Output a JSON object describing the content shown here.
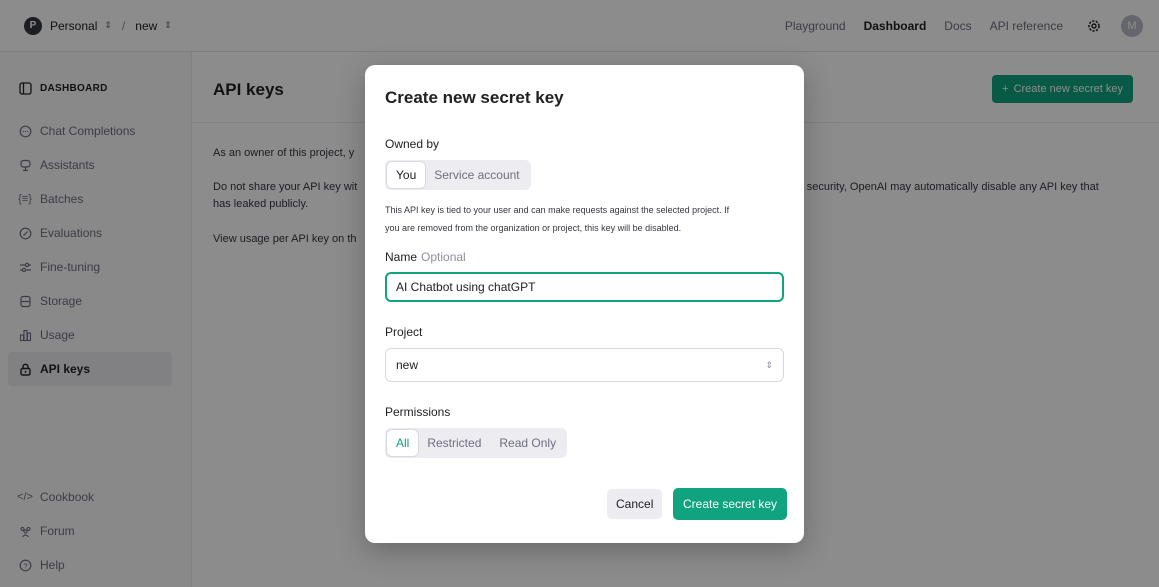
{
  "topbar": {
    "org_initial": "P",
    "org_name": "Personal",
    "separator": "/",
    "project_name": "new",
    "nav": [
      "Playground",
      "Dashboard",
      "Docs",
      "API reference"
    ],
    "active_nav": "Dashboard",
    "avatar_initial": "M"
  },
  "sidebar": {
    "header": "DASHBOARD",
    "items": [
      {
        "label": "Chat Completions",
        "icon": "chat-bubble-icon"
      },
      {
        "label": "Assistants",
        "icon": "assistant-icon"
      },
      {
        "label": "Batches",
        "icon": "batches-icon"
      },
      {
        "label": "Evaluations",
        "icon": "evaluations-icon"
      },
      {
        "label": "Fine-tuning",
        "icon": "fine-tuning-icon"
      },
      {
        "label": "Storage",
        "icon": "database-icon"
      },
      {
        "label": "Usage",
        "icon": "bar-chart-icon"
      },
      {
        "label": "API keys",
        "icon": "lock-icon"
      }
    ],
    "active_item": "API keys",
    "bottom_items": [
      {
        "label": "Cookbook",
        "icon": "code-icon"
      },
      {
        "label": "Forum",
        "icon": "people-icon"
      },
      {
        "label": "Help",
        "icon": "help-icon"
      }
    ]
  },
  "main": {
    "title": "API keys",
    "create_button": "Create new secret key",
    "para1_start": "As an owner of this project, y",
    "para2_start": "Do not share your API key wit",
    "para2_end": "t's security, OpenAI may automatically disable any API key that",
    "para2_line2": "has leaked publicly.",
    "para3_start": "View usage per API key on th"
  },
  "modal": {
    "title": "Create new secret key",
    "owned_by_label": "Owned by",
    "owned_by_options": [
      "You",
      "Service account"
    ],
    "owned_by_selected": "You",
    "help_line1": "This API key is tied to your user and can make requests against the selected project. If",
    "help_line2": "you are removed from the organization or project, this key will be disabled.",
    "name_label": "Name",
    "name_optional": "Optional",
    "name_value": "AI Chatbot using chatGPT",
    "project_label": "Project",
    "project_value": "new",
    "permissions_label": "Permissions",
    "permissions_options": [
      "All",
      "Restricted",
      "Read Only"
    ],
    "permissions_selected": "All",
    "cancel_label": "Cancel",
    "submit_label": "Create secret key"
  },
  "colors": {
    "accent": "#10a37f",
    "overlay": "#000000"
  }
}
